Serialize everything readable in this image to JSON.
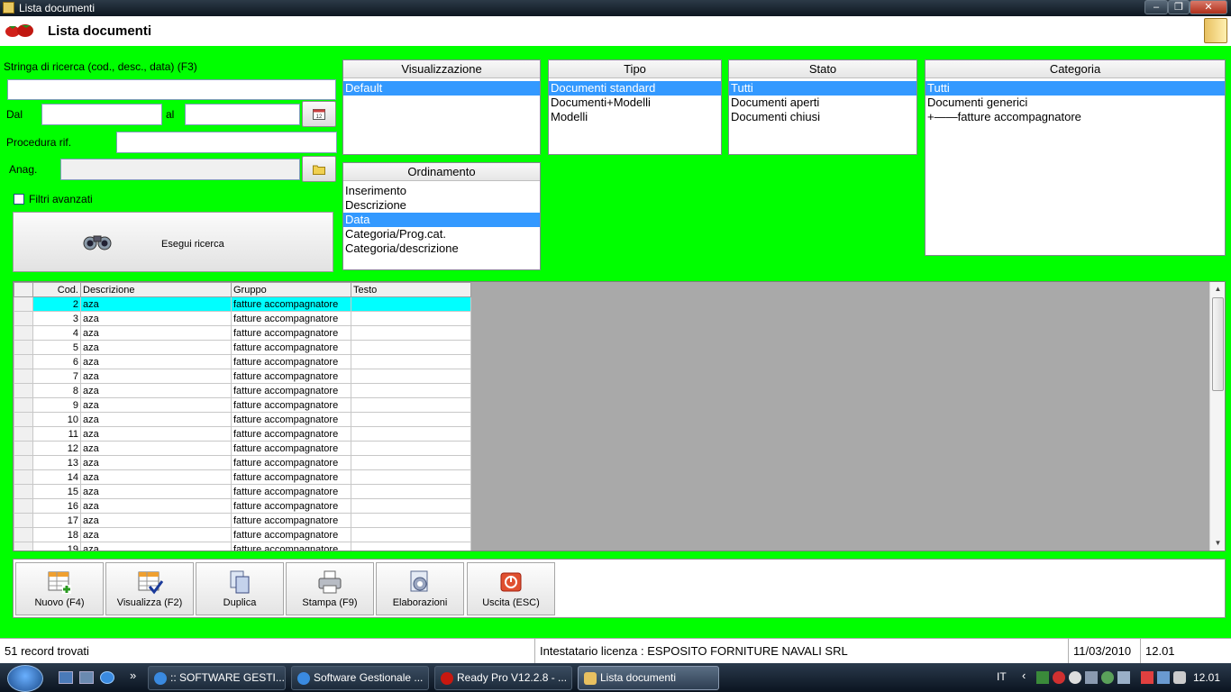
{
  "window": {
    "title": "Lista documenti"
  },
  "header": {
    "title": "Lista documenti"
  },
  "search": {
    "label": "Stringa di ricerca (cod., desc., data) (F3)",
    "value": "",
    "dal_label": "Dal",
    "al_label": "al",
    "procedura_label": "Procedura rif.",
    "anag_label": "Anag.",
    "filtri_label": "Filtri avanzati",
    "filtri_checked": false,
    "execute_label": "Esegui ricerca"
  },
  "visualizzazione": {
    "title": "Visualizzazione",
    "items": [
      "Default"
    ],
    "selected": 0
  },
  "tipo": {
    "title": "Tipo",
    "items": [
      "Documenti standard",
      "Documenti+Modelli",
      "Modelli"
    ],
    "selected": 0
  },
  "stato": {
    "title": "Stato",
    "items": [
      "Tutti",
      "Documenti aperti",
      "Documenti chiusi"
    ],
    "selected": 0
  },
  "categoria": {
    "title": "Categoria",
    "items": [
      "Tutti",
      "Documenti generici",
      "+——fatture accompagnatore"
    ],
    "selected": 0
  },
  "ordinamento": {
    "title": "Ordinamento",
    "items": [
      "Inserimento",
      "Descrizione",
      "Data",
      "Categoria/Prog.cat.",
      "Categoria/descrizione"
    ],
    "selected": 2
  },
  "grid": {
    "columns": [
      "Cod.",
      "Descrizione",
      "Gruppo",
      "Testo"
    ],
    "rows": [
      [
        "2",
        "aza",
        "fatture accompagnatore",
        ""
      ],
      [
        "3",
        "aza",
        "fatture accompagnatore",
        ""
      ],
      [
        "4",
        "aza",
        "fatture accompagnatore",
        ""
      ],
      [
        "5",
        "aza",
        "fatture accompagnatore",
        ""
      ],
      [
        "6",
        "aza",
        "fatture accompagnatore",
        ""
      ],
      [
        "7",
        "aza",
        "fatture accompagnatore",
        ""
      ],
      [
        "8",
        "aza",
        "fatture accompagnatore",
        ""
      ],
      [
        "9",
        "aza",
        "fatture accompagnatore",
        ""
      ],
      [
        "10",
        "aza",
        "fatture accompagnatore",
        ""
      ],
      [
        "11",
        "aza",
        "fatture accompagnatore",
        ""
      ],
      [
        "12",
        "aza",
        "fatture accompagnatore",
        ""
      ],
      [
        "13",
        "aza",
        "fatture accompagnatore",
        ""
      ],
      [
        "14",
        "aza",
        "fatture accompagnatore",
        ""
      ],
      [
        "15",
        "aza",
        "fatture accompagnatore",
        ""
      ],
      [
        "16",
        "aza",
        "fatture accompagnatore",
        ""
      ],
      [
        "17",
        "aza",
        "fatture accompagnatore",
        ""
      ],
      [
        "18",
        "aza",
        "fatture accompagnatore",
        ""
      ],
      [
        "19",
        "aza",
        "fatture accompagnatore",
        ""
      ]
    ],
    "selected_row": 0
  },
  "toolbar": {
    "buttons": [
      {
        "label": "Nuovo (F4)",
        "icon": "new-grid-icon"
      },
      {
        "label": "Visualizza (F2)",
        "icon": "view-check-icon"
      },
      {
        "label": "Duplica",
        "icon": "duplicate-icon"
      },
      {
        "label": "Stampa (F9)",
        "icon": "printer-icon"
      },
      {
        "label": "Elaborazioni",
        "icon": "gear-document-icon"
      },
      {
        "label": "Uscita (ESC)",
        "icon": "power-icon"
      }
    ]
  },
  "status": {
    "records": "51 record trovati",
    "license": "Intestatario licenza : ESPOSITO FORNITURE NAVALI SRL",
    "date": "11/03/2010",
    "time": "12.01"
  },
  "taskbar": {
    "items": [
      {
        "label": ":: SOFTWARE GESTI...",
        "active": false
      },
      {
        "label": "Software Gestionale ...",
        "active": false
      },
      {
        "label": "Ready Pro V12.2.8 - ...",
        "active": false
      },
      {
        "label": "Lista documenti",
        "active": true
      }
    ],
    "lang": "IT",
    "clock": "12.01"
  },
  "colors": {
    "background": "#00ff00",
    "selection": "#3399ff",
    "grid_selection": "#00ffff"
  }
}
